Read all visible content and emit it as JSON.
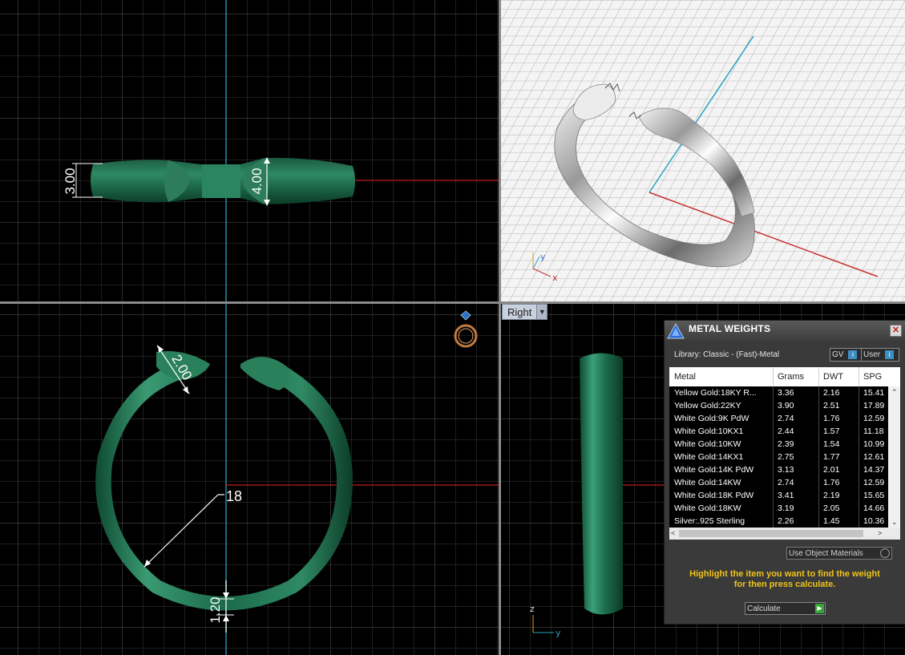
{
  "dimensions": {
    "top_width": "3.00",
    "top_height": "4.00",
    "front_tip": "2.00",
    "front_diameter": "18",
    "front_thickness": "1.20"
  },
  "axes": {
    "x": "x",
    "y": "y",
    "z": "z"
  },
  "viewport_right": {
    "label": "Right"
  },
  "panel": {
    "title": "METAL WEIGHTS",
    "library": "Library: Classic - (Fast)-Metal",
    "gv_label": "GV",
    "user_label": "User",
    "columns": [
      "Metal",
      "Grams",
      "DWT",
      "SPG"
    ],
    "rows": [
      {
        "metal": "Yellow Gold:18KY R...",
        "grams": "3.36",
        "dwt": "2.16",
        "spg": "15.41"
      },
      {
        "metal": "Yellow Gold:22KY",
        "grams": "3.90",
        "dwt": "2.51",
        "spg": "17.89"
      },
      {
        "metal": "White Gold:9K PdW",
        "grams": "2.74",
        "dwt": "1.76",
        "spg": "12.59"
      },
      {
        "metal": "White Gold:10KX1",
        "grams": "2.44",
        "dwt": "1.57",
        "spg": "11.18"
      },
      {
        "metal": "White Gold:10KW",
        "grams": "2.39",
        "dwt": "1.54",
        "spg": "10.99"
      },
      {
        "metal": "White Gold:14KX1",
        "grams": "2.75",
        "dwt": "1.77",
        "spg": "12.61"
      },
      {
        "metal": "White Gold:14K PdW",
        "grams": "3.13",
        "dwt": "2.01",
        "spg": "14.37"
      },
      {
        "metal": "White Gold:14KW",
        "grams": "2.74",
        "dwt": "1.76",
        "spg": "12.59"
      },
      {
        "metal": "White Gold:18K PdW",
        "grams": "3.41",
        "dwt": "2.19",
        "spg": "15.65"
      },
      {
        "metal": "White Gold:18KW",
        "grams": "3.19",
        "dwt": "2.05",
        "spg": "14.66"
      },
      {
        "metal": "Silver:.925 Sterling",
        "grams": "2.26",
        "dwt": "1.45",
        "spg": "10.36"
      }
    ],
    "use_object_materials": "Use Object Materials",
    "hint_line1": "Highlight the item you want to find the weight",
    "hint_line2": "for then press calculate.",
    "calculate_label": "Calculate"
  }
}
